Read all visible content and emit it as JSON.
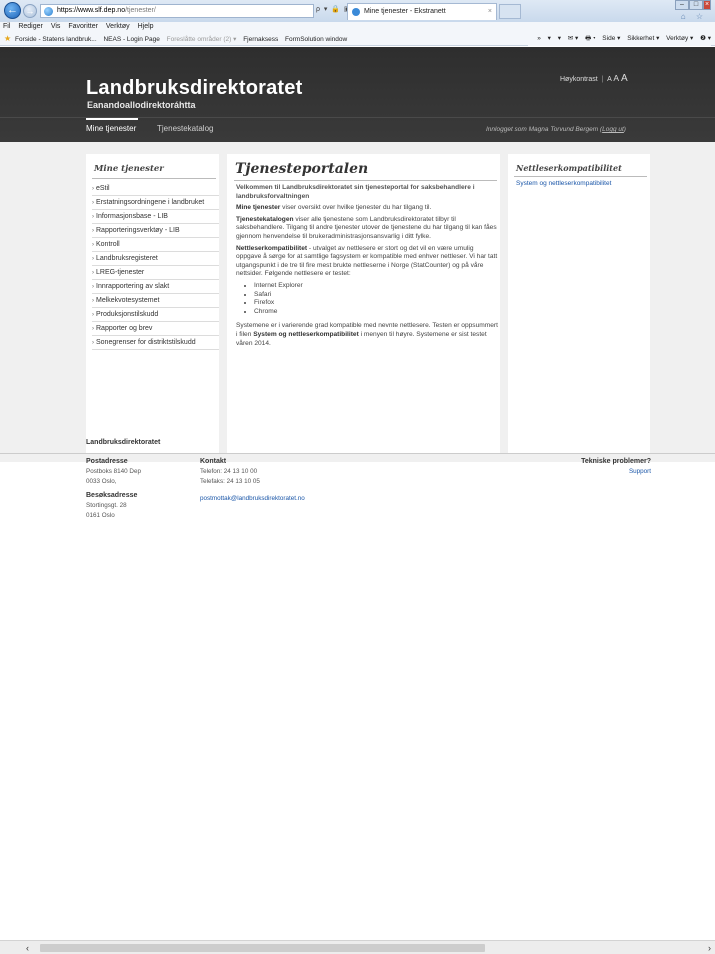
{
  "browser": {
    "url_host": "https://www.slf.dep.no",
    "url_path": "/tjenester/",
    "address_tools": "ρ ▾ 🔒 ▣ C",
    "tab_title": "Mine tjenester - Ekstranett",
    "tab_close": "×",
    "menu": [
      "Fil",
      "Rediger",
      "Vis",
      "Favoritter",
      "Verktøy",
      "Hjelp"
    ],
    "favorites": [
      {
        "label": "Forside - Statens landbruk...",
        "dim": false
      },
      {
        "label": "NEAS - Login Page",
        "dim": false
      },
      {
        "label": "Foreslåtte områder (2) ▾",
        "dim": true
      },
      {
        "label": "Fjernaksess",
        "dim": false
      },
      {
        "label": "FormSolution window",
        "dim": false
      }
    ],
    "command_bar": [
      "»",
      "▾",
      "▾",
      "✉ ▾",
      "🖶 ▾",
      "Side ▾",
      "Sikkerhet ▾",
      "Verktøy ▾",
      "❷ ▾"
    ],
    "home_icons": "⌂ ☆"
  },
  "header": {
    "title": "Landbruksdirektoratet",
    "subtitle": "Eanandoallodirektoráhtta",
    "contrast_label": "Høykontrast",
    "contrast_sep": "|",
    "size_a": "A",
    "nav_mine": "Mine tjenester",
    "nav_katalog": "Tjenestekatalog",
    "logged_in_prefix": "Innlogget som Magna Torvund Bergem (",
    "logout": "Logg ut",
    "logged_in_suffix": ")"
  },
  "left": {
    "title": "Mine tjenester",
    "items": [
      "eStil",
      "Erstatningsordningene i landbruket",
      "Informasjonsbase - LIB",
      "Rapporteringsverktøy - LIB",
      "Kontroll",
      "Landbruksregisteret",
      "LREG-tjenester",
      "Innrapportering av slakt",
      "Melkekvotesystemet",
      "Produksjonstilskudd",
      "Rapporter og brev",
      "Sonegrenser for distriktstilskudd"
    ]
  },
  "center": {
    "title": "Tjenesteportalen",
    "lead": "Velkommen til Landbruksdirektoratet sin tjenesteportal for saksbehandlere i landbruksforvaltningen",
    "p1_bold": "Mine tjenester",
    "p1_text": " viser oversikt over hvilke tjenester du har tilgang til.",
    "p2_bold": "Tjenestekatalogen",
    "p2_text": " viser alle tjenestene som Landbruksdirektoratet tilbyr til saksbehandlere. Tilgang til andre tjenester utover de tjenestene du har tilgang til kan fåes gjennom henvendelse til brukeradministrasjonsansvarlig i ditt fylke.",
    "p3_bold": "Nettleserkompatibilitet",
    "p3_text": " - utvalget av nettlesere er stort og det vil en være umulig oppgave å sørge for at samtlige fagsystem er kompatible med enhver nettleser. Vi har tatt utgangspunkt i de tre til fire mest brukte nettleserne i Norge (StatCounter) og på våre nettsider. Følgende nettlesere er testet:",
    "browsers": [
      "Internet Explorer",
      "Safari",
      "Firefox",
      "Chrome"
    ],
    "p4_text1": "Systemene er i varierende grad kompatible med nevnte nettlesere. Testen er oppsummert i filen ",
    "p4_bold": "System og nettleserkompatibilitet",
    "p4_text2": " i menyen til høyre. Systemene er sist testet våren 2014."
  },
  "right": {
    "title": "Nettleserkompatibilitet",
    "link": "System og nettleserkompatibilitet"
  },
  "footer": {
    "org": "Landbruksdirektoratet",
    "post_head": "Postadresse",
    "post_1": "Postboks 8140 Dep",
    "post_2": "0033 Oslo,",
    "visit_head": "Besøksadresse",
    "visit_1": "Stortingsgt. 28",
    "visit_2": "0161 Oslo",
    "contact_head": "Kontakt",
    "contact_phone": "Telefon: 24 13 10 00",
    "contact_fax": "Telefaks: 24 13 10 05",
    "contact_email": "postmottak@landbruksdirektoratet.no",
    "tech_head": "Tekniske problemer?",
    "tech_link": "Support"
  },
  "colors": {
    "header_bg": "#333333",
    "link": "#1a56a8",
    "content_bg": "#f0f0f0"
  }
}
